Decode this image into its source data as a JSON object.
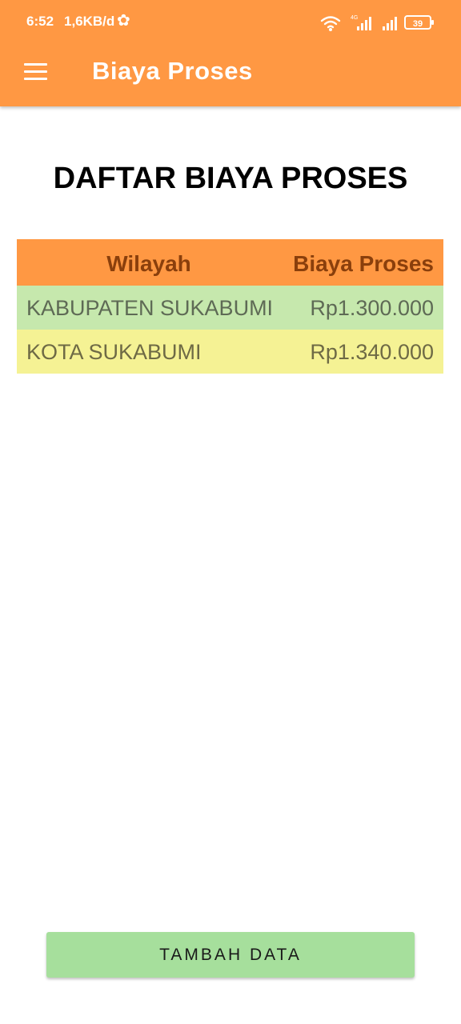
{
  "status_bar": {
    "time": "6:52",
    "network_speed": "1,6KB/d",
    "settings_icon": "gear-icon",
    "wifi_icon": "wifi-icon",
    "signal_icon": "signal-icon",
    "network_type": "4G",
    "battery_level": "39"
  },
  "app_bar": {
    "menu_icon": "hamburger-menu-icon",
    "title": "Biaya Proses",
    "color": "#FF9843"
  },
  "main": {
    "page_title": "DAFTAR BIAYA PROSES",
    "table": {
      "columns": [
        "Wilayah",
        "Biaya Proses"
      ],
      "header_color": "#FF9843",
      "rows": [
        {
          "wilayah": "KABUPATEN SUKABUMI",
          "biaya": "Rp1.300.000",
          "color": "#C6E8AD"
        },
        {
          "wilayah": "KOTA SUKABUMI",
          "biaya": "Rp1.340.000",
          "color": "#F5F294"
        }
      ]
    },
    "add_button_label": "TAMBAH DATA",
    "add_button_color": "#A6DF9C"
  }
}
